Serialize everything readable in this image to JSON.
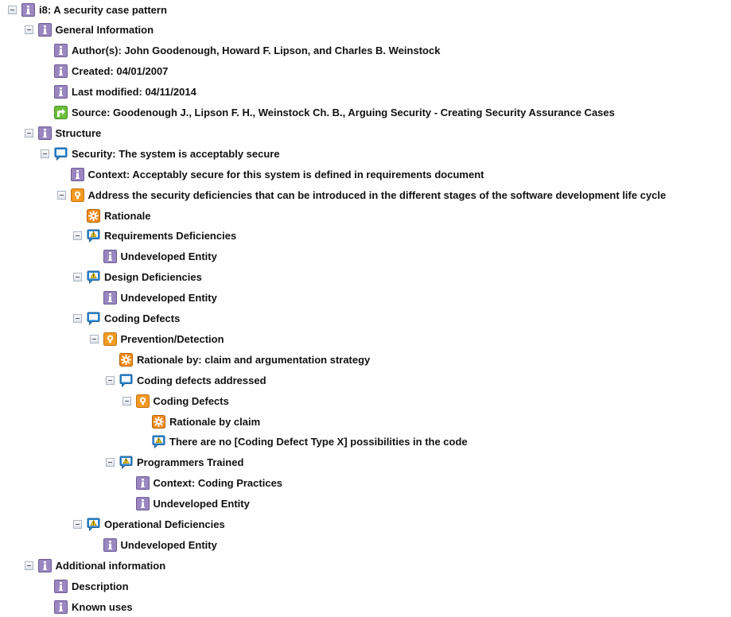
{
  "colors": {
    "info": "#9a87c0",
    "info_root": "#8a74b8",
    "context": "#9a87c0",
    "goal": "#2a86d1",
    "goal_border": "#1f5f9a",
    "strategy": "#f29a22",
    "rationale": "#f28a1a",
    "warning": "#f5d31a",
    "source": "#6cbf3a"
  },
  "tree": [
    {
      "depth": 0,
      "toggle": true,
      "icon": "info-icon",
      "label": "i8: A security case pattern",
      "name": "node-root"
    },
    {
      "depth": 1,
      "toggle": true,
      "icon": "info-icon",
      "label": "General Information",
      "name": "node-general-information"
    },
    {
      "depth": 2,
      "toggle": false,
      "icon": "info-icon",
      "label": "Author(s): John Goodenough, Howard F. Lipson, and Charles B. Weinstock",
      "name": "node-authors"
    },
    {
      "depth": 2,
      "toggle": false,
      "icon": "info-icon",
      "label": "Created: 04/01/2007",
      "name": "node-created"
    },
    {
      "depth": 2,
      "toggle": false,
      "icon": "info-icon",
      "label": "Last modified: 04/11/2014",
      "name": "node-last-modified"
    },
    {
      "depth": 2,
      "toggle": false,
      "icon": "source-link-icon",
      "label": "Source: Goodenough J., Lipson F. H., Weinstock Ch. B., Arguing Security - Creating Security Assurance Cases",
      "name": "node-source"
    },
    {
      "depth": 1,
      "toggle": true,
      "icon": "info-icon",
      "label": "Structure",
      "name": "node-structure"
    },
    {
      "depth": 2,
      "toggle": true,
      "icon": "goal-icon",
      "label": "Security: The system is acceptably secure",
      "name": "node-security-goal"
    },
    {
      "depth": 3,
      "toggle": false,
      "icon": "info-icon",
      "label": "Context: Acceptably secure for this system is defined in requirements document",
      "name": "node-context-acceptably-secure"
    },
    {
      "depth": 3,
      "toggle": true,
      "icon": "strategy-icon",
      "label": "Address the security deficiencies that can be introduced in the different stages of the software development life cycle",
      "name": "node-address-deficiencies"
    },
    {
      "depth": 4,
      "toggle": false,
      "icon": "rationale-icon",
      "label": "Rationale",
      "name": "node-rationale"
    },
    {
      "depth": 4,
      "toggle": true,
      "icon": "goal-warning-icon",
      "label": "Requirements Deficiencies",
      "name": "node-requirements-deficiencies"
    },
    {
      "depth": 5,
      "toggle": false,
      "icon": "info-icon",
      "label": "Undeveloped Entity",
      "name": "node-undeveloped-1"
    },
    {
      "depth": 4,
      "toggle": true,
      "icon": "goal-warning-icon",
      "label": "Design Deficiencies",
      "name": "node-design-deficiencies"
    },
    {
      "depth": 5,
      "toggle": false,
      "icon": "info-icon",
      "label": "Undeveloped Entity",
      "name": "node-undeveloped-2"
    },
    {
      "depth": 4,
      "toggle": true,
      "icon": "goal-icon",
      "label": "Coding Defects",
      "name": "node-coding-defects"
    },
    {
      "depth": 5,
      "toggle": true,
      "icon": "strategy-icon",
      "label": "Prevention/Detection",
      "name": "node-prevention-detection"
    },
    {
      "depth": 6,
      "toggle": false,
      "icon": "rationale-icon",
      "label": "Rationale by: claim and argumentation strategy",
      "name": "node-rationale-claim-strategy"
    },
    {
      "depth": 6,
      "toggle": true,
      "icon": "goal-icon",
      "label": "Coding defects addressed",
      "name": "node-coding-defects-addressed"
    },
    {
      "depth": 7,
      "toggle": true,
      "icon": "strategy-icon",
      "label": "Coding Defects",
      "name": "node-coding-defects-strategy"
    },
    {
      "depth": 8,
      "toggle": false,
      "icon": "rationale-icon",
      "label": "Rationale by claim",
      "name": "node-rationale-by-claim"
    },
    {
      "depth": 8,
      "toggle": false,
      "icon": "goal-warning-icon",
      "label": "There are no [Coding Defect Type X] possibilities in the code",
      "name": "node-no-defect-type-x"
    },
    {
      "depth": 6,
      "toggle": true,
      "icon": "goal-warning-icon",
      "label": "Programmers Trained",
      "name": "node-programmers-trained"
    },
    {
      "depth": 7,
      "toggle": false,
      "icon": "info-icon",
      "label": "Context: Coding Practices",
      "name": "node-context-coding-practices"
    },
    {
      "depth": 7,
      "toggle": false,
      "icon": "info-icon",
      "label": "Undeveloped Entity",
      "name": "node-undeveloped-3"
    },
    {
      "depth": 4,
      "toggle": true,
      "icon": "goal-warning-icon",
      "label": "Operational Deficiencies",
      "name": "node-operational-deficiencies"
    },
    {
      "depth": 5,
      "toggle": false,
      "icon": "info-icon",
      "label": "Undeveloped Entity",
      "name": "node-undeveloped-4"
    },
    {
      "depth": 1,
      "toggle": true,
      "icon": "info-icon",
      "label": "Additional information",
      "name": "node-additional-information"
    },
    {
      "depth": 2,
      "toggle": false,
      "icon": "info-icon",
      "label": "Description",
      "name": "node-description"
    },
    {
      "depth": 2,
      "toggle": false,
      "icon": "info-icon",
      "label": "Known uses",
      "name": "node-known-uses"
    }
  ]
}
